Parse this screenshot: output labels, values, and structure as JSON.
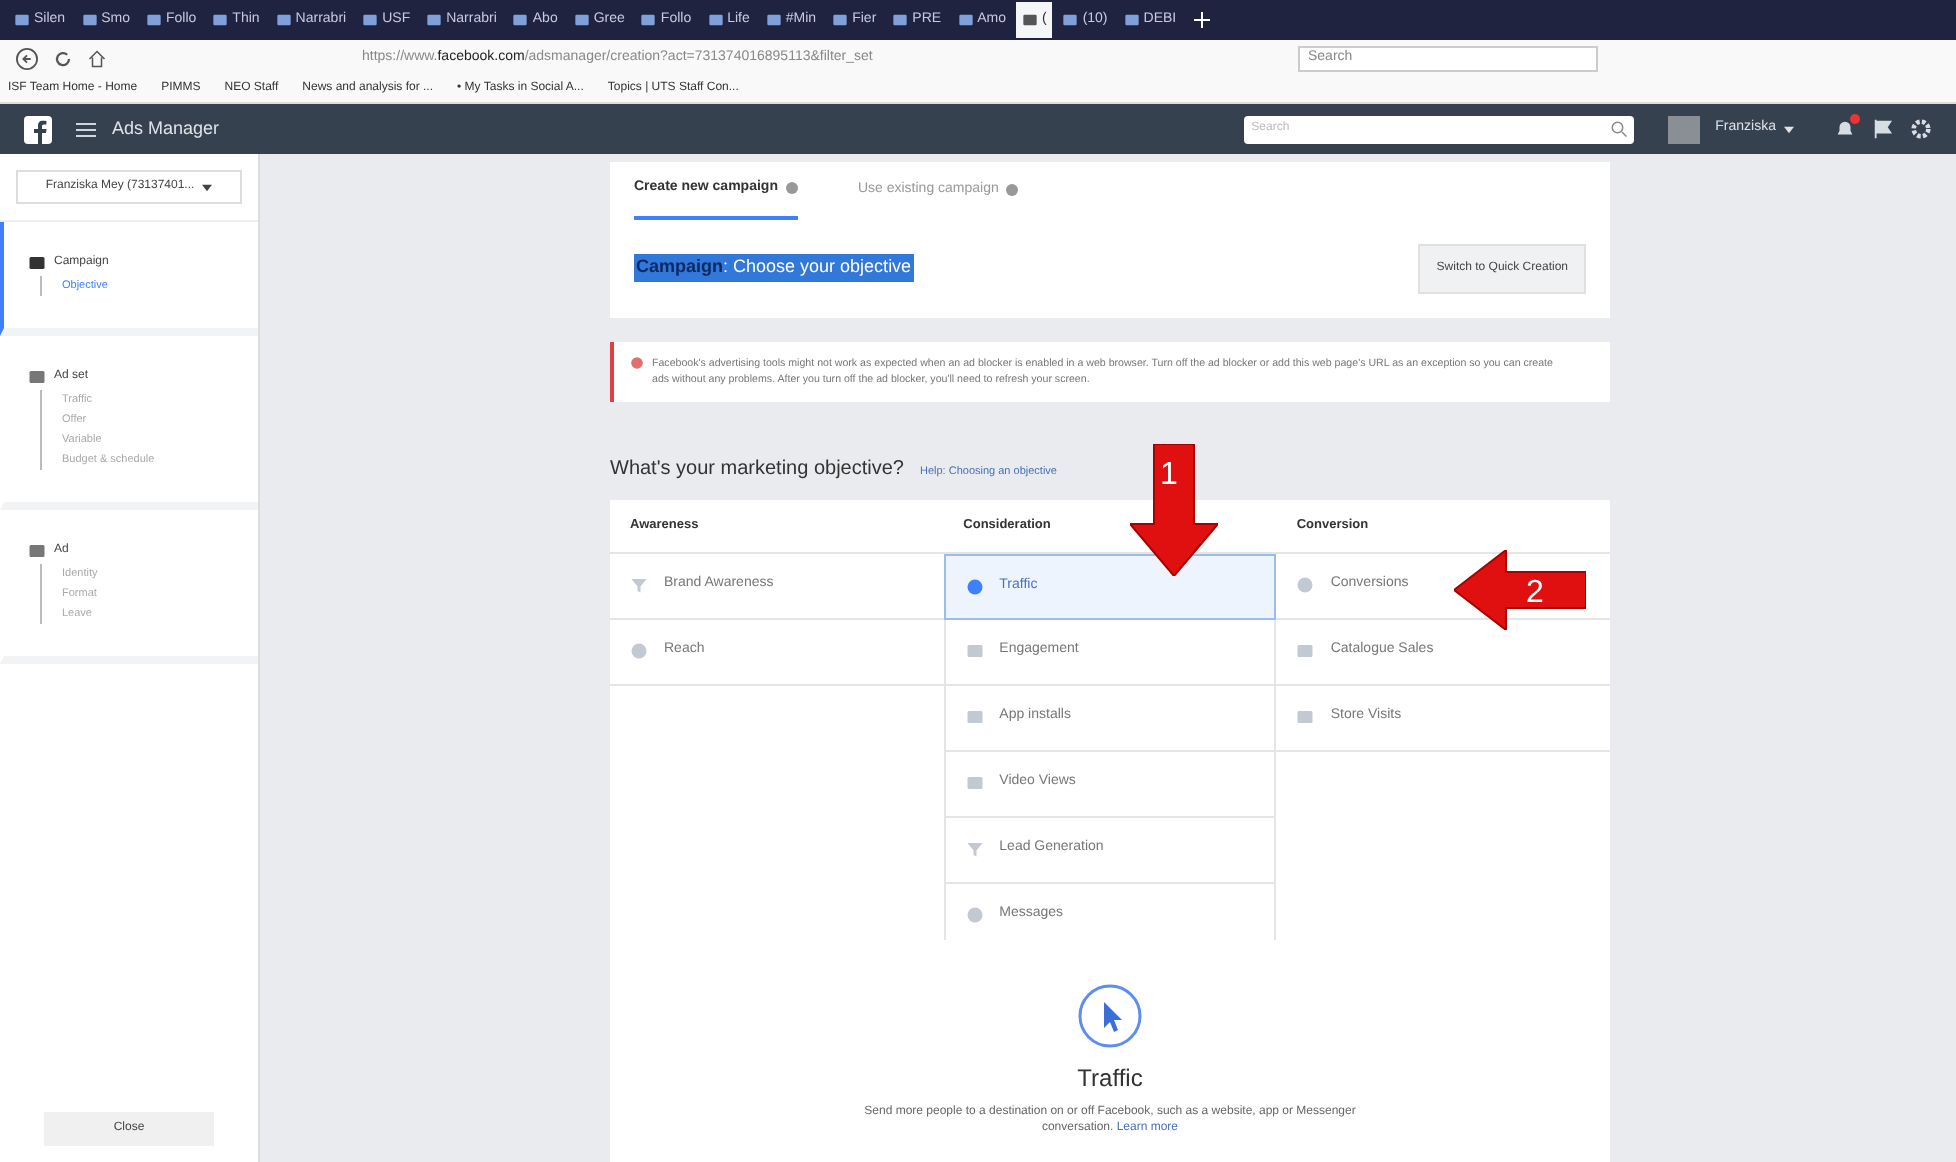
{
  "browser": {
    "tabs": [
      {
        "label": "Silen",
        "selected": false
      },
      {
        "label": "Smo",
        "selected": false
      },
      {
        "label": "Follo",
        "selected": false
      },
      {
        "label": "Thin",
        "selected": false
      },
      {
        "label": "Narrabri",
        "selected": false
      },
      {
        "label": "USF",
        "selected": false
      },
      {
        "label": "Narrabri",
        "selected": false
      },
      {
        "label": "Abo",
        "selected": false
      },
      {
        "label": "Gree",
        "selected": false
      },
      {
        "label": "Follo",
        "selected": false
      },
      {
        "label": "Life",
        "selected": false
      },
      {
        "label": "#Min",
        "selected": false
      },
      {
        "label": "Fier",
        "selected": false
      },
      {
        "label": "PRE",
        "selected": false
      },
      {
        "label": "Amo",
        "selected": false
      },
      {
        "label": "(",
        "selected": true
      },
      {
        "label": "(10)",
        "selected": false
      },
      {
        "label": "DEBI",
        "selected": false
      }
    ],
    "url_prefix": "https://www.",
    "url_domain": "facebook.com",
    "url_rest": "/adsmanager/creation?act=731374016895113&filter_set",
    "search_placeholder": "Search",
    "bookmarks": [
      "ISF Team Home - Home",
      "PIMMS",
      "NEO Staff",
      "News and analysis for ...",
      "• My Tasks in Social A...",
      "Topics | UTS Staff Con..."
    ]
  },
  "header": {
    "title": "Ads Manager",
    "search_placeholder": "Search",
    "user": "Franziska",
    "notifications": true
  },
  "sidebar": {
    "account": "Franziska Mey (73137401...",
    "sections": [
      {
        "title": "Campaign",
        "selected": true,
        "children": [
          {
            "label": "Objective",
            "selected": true
          }
        ]
      },
      {
        "title": "Ad set",
        "selected": false,
        "children": [
          {
            "label": "Traffic",
            "selected": false
          },
          {
            "label": "Offer",
            "selected": false
          },
          {
            "label": "Variable",
            "selected": false
          },
          {
            "label": "Budget & schedule",
            "selected": false
          }
        ]
      },
      {
        "title": "Ad",
        "selected": false,
        "children": [
          {
            "label": "Identity",
            "selected": false
          },
          {
            "label": "Format",
            "selected": false
          },
          {
            "label": "Leave",
            "selected": false
          }
        ]
      }
    ],
    "close": "Close"
  },
  "main": {
    "tabs": [
      {
        "label": "Create new campaign",
        "selected": true
      },
      {
        "label": "Use existing campaign",
        "selected": false
      }
    ],
    "heading_bold": "Campaign",
    "heading_text": ": Choose your objective",
    "quick_creation": "Switch to Quick Creation",
    "alert": "Facebook's advertising tools might not work as expected when an ad blocker is enabled in a web browser. Turn off the ad blocker or add this web page's URL as an exception so you can create ads without any problems. After you turn off the ad blocker, you'll need to refresh your screen.",
    "objective_title": "What's your marketing objective?",
    "help_link": "Help: Choosing an objective",
    "columns": [
      {
        "title": "Awareness",
        "items": [
          {
            "label": "Brand Awareness",
            "selected": false
          },
          {
            "label": "Reach",
            "selected": false
          }
        ]
      },
      {
        "title": "Consideration",
        "items": [
          {
            "label": "Traffic",
            "selected": true
          },
          {
            "label": "Engagement",
            "selected": false
          },
          {
            "label": "App installs",
            "selected": false
          },
          {
            "label": "Video Views",
            "selected": false
          },
          {
            "label": "Lead Generation",
            "selected": false
          },
          {
            "label": "Messages",
            "selected": false
          }
        ]
      },
      {
        "title": "Conversion",
        "items": [
          {
            "label": "Conversions",
            "selected": false
          },
          {
            "label": "Catalogue Sales",
            "selected": false
          },
          {
            "label": "Store Visits",
            "selected": false
          }
        ]
      }
    ],
    "detail": {
      "title": "Traffic",
      "text": "Send more people to a destination on or off Facebook, such as a website, app or Messenger conversation.",
      "link": "Learn more"
    },
    "annotations": [
      {
        "number": "1",
        "kind": "down"
      },
      {
        "number": "2",
        "kind": "left"
      }
    ]
  }
}
